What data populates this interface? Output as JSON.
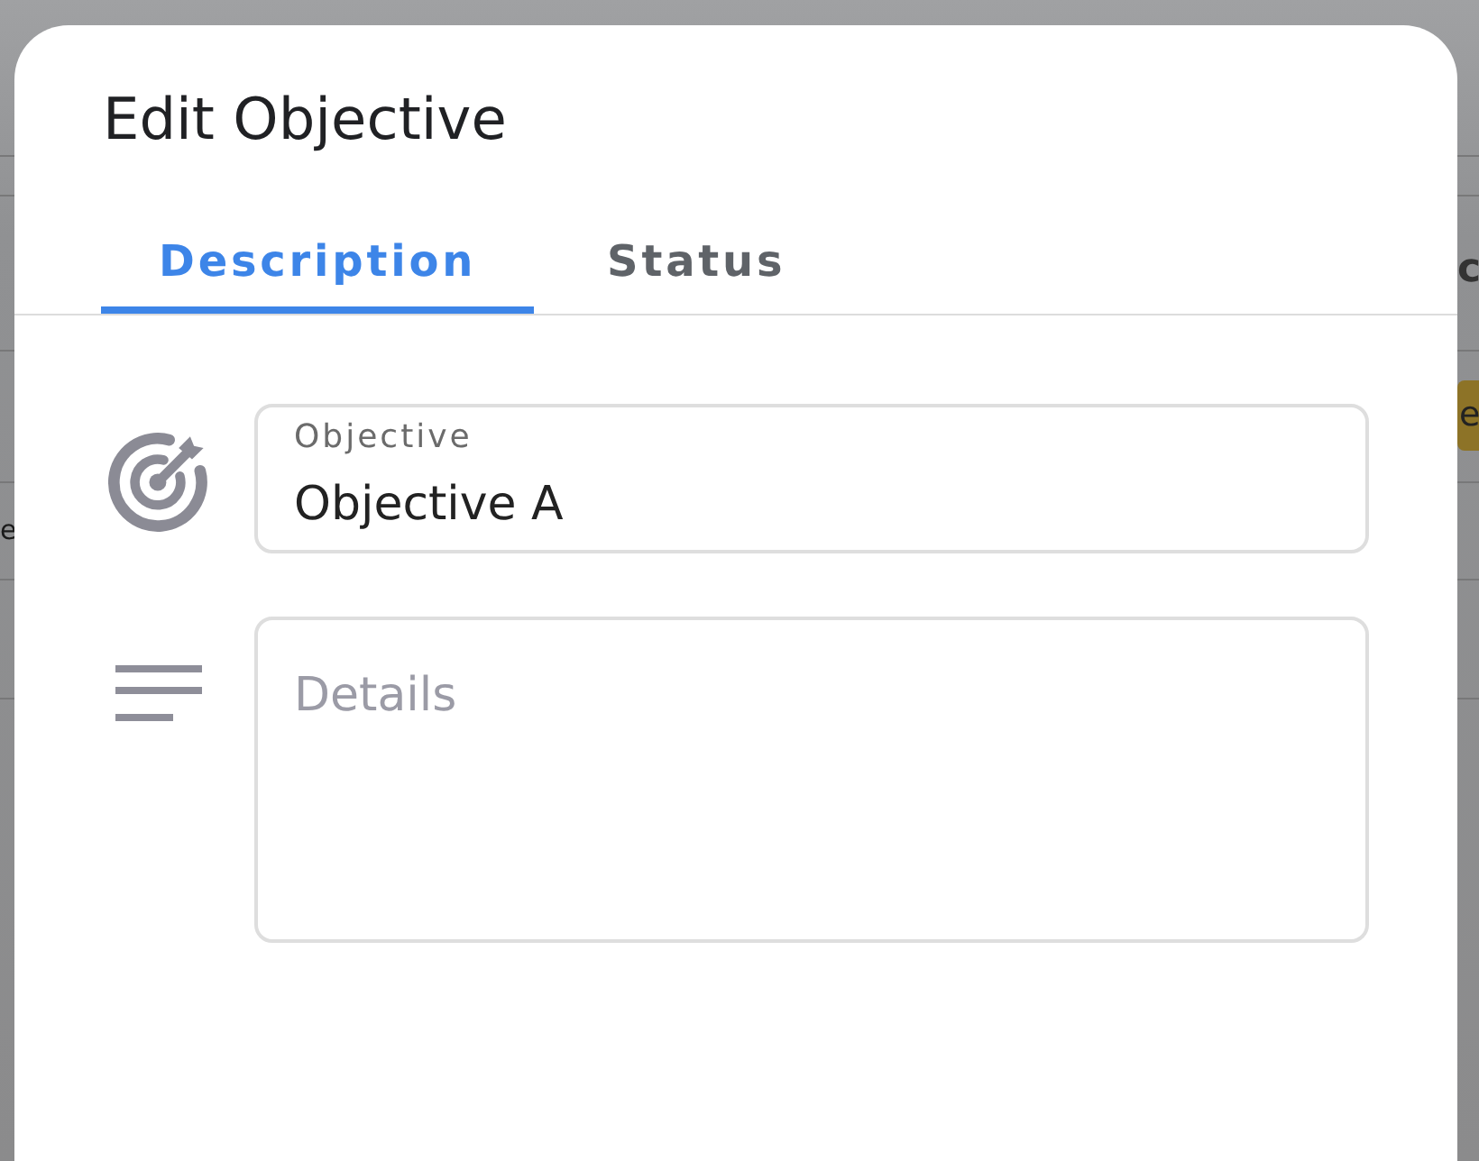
{
  "backdrop": {
    "fragments": [
      {
        "kind": "heading",
        "text": "c"
      },
      {
        "kind": "badge",
        "text": "e"
      },
      {
        "kind": "cell",
        "text": "e"
      }
    ]
  },
  "dialog": {
    "title": "Edit Objective"
  },
  "tabs": [
    {
      "label": "Description",
      "selected": true
    },
    {
      "label": "Status",
      "selected": false
    }
  ],
  "fields": [
    {
      "kind": "text",
      "label": "Objective",
      "value": "Objective A"
    },
    {
      "kind": "textarea",
      "placeholder": "Details"
    }
  ]
}
